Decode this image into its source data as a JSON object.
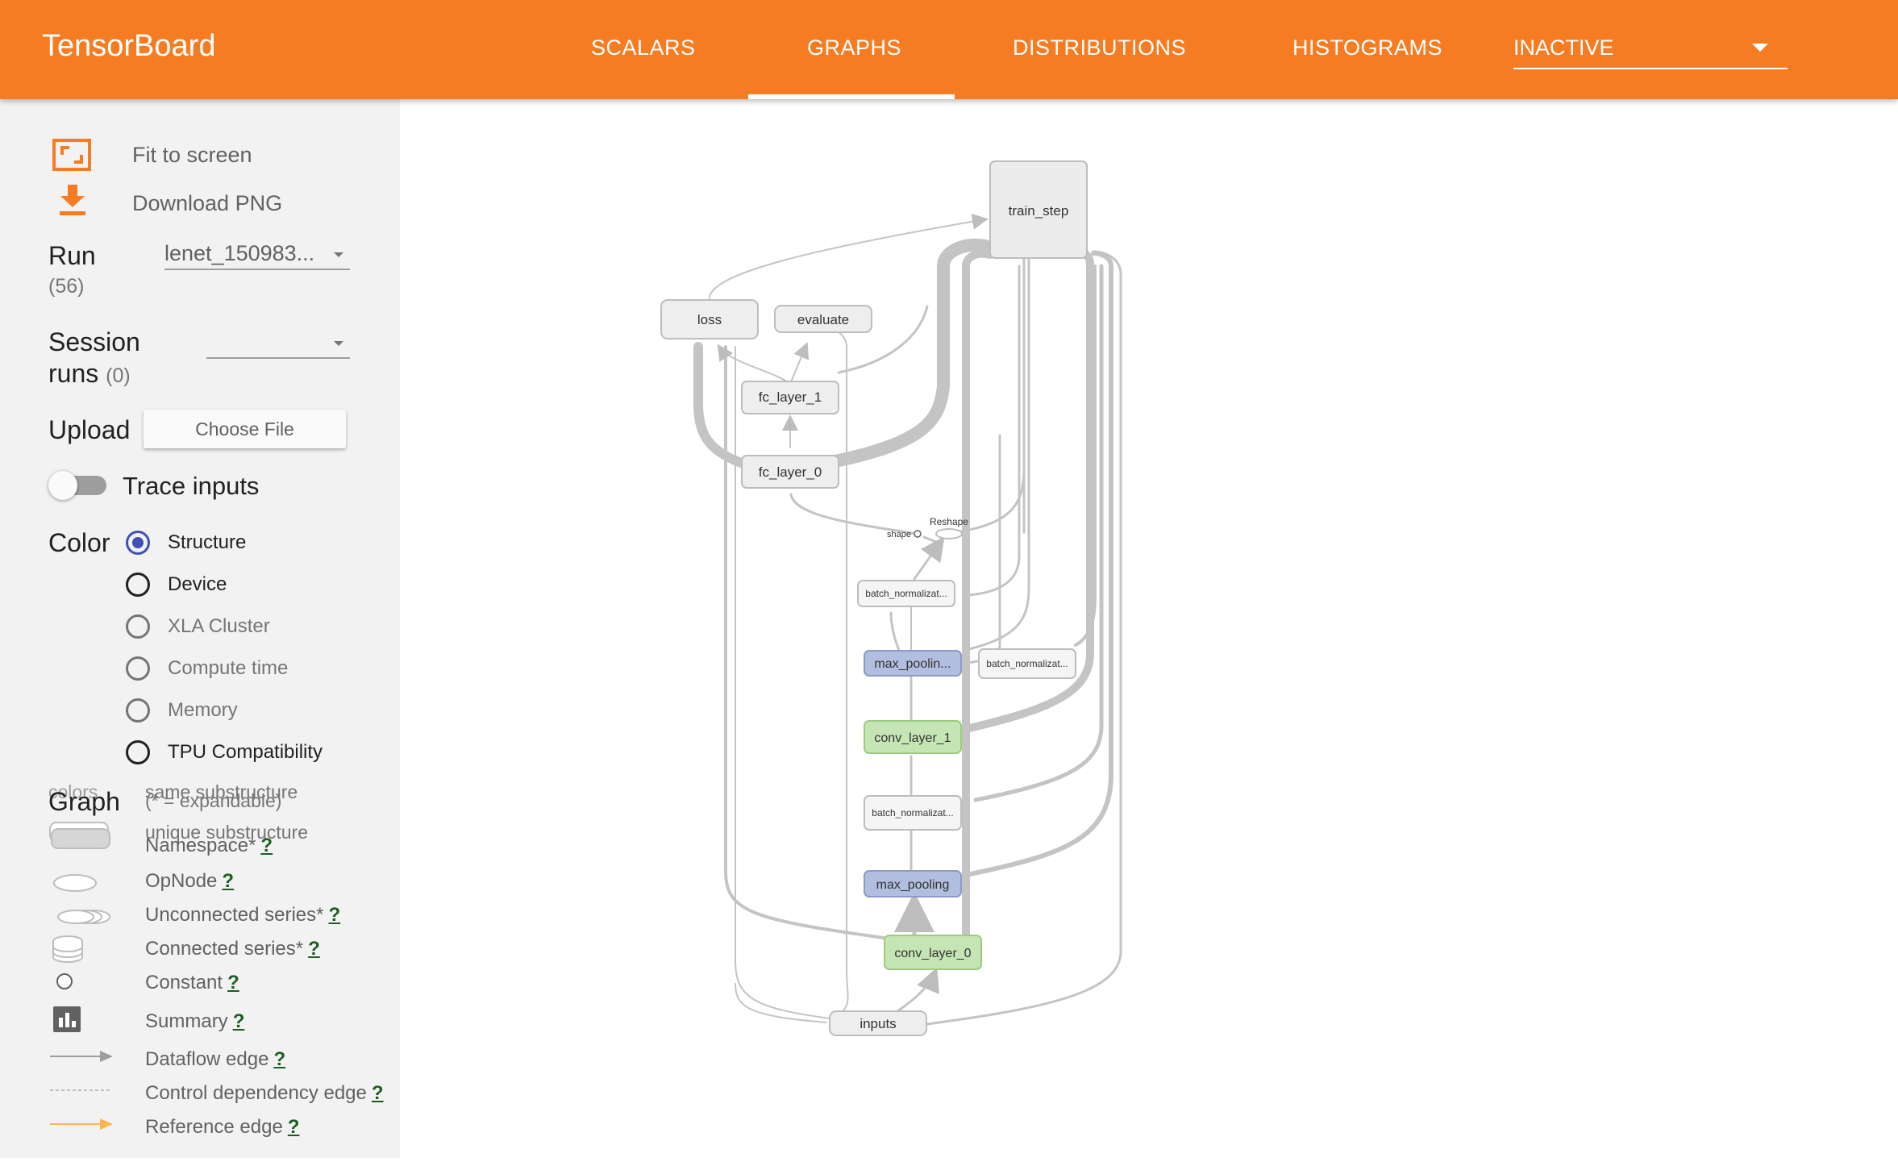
{
  "app_title": "TensorBoard",
  "tabs": [
    {
      "label": "SCALARS"
    },
    {
      "label": "GRAPHS"
    },
    {
      "label": "DISTRIBUTIONS"
    },
    {
      "label": "HISTOGRAMS"
    }
  ],
  "active_tab": "GRAPHS",
  "inactive_dropdown": {
    "value": "INACTIVE"
  },
  "sidebar": {
    "fit_to_screen": "Fit to screen",
    "download_png": "Download PNG",
    "run_label": "Run",
    "run_count": "(56)",
    "run_value": "lenet_150983...",
    "session_label_1": "Session",
    "session_label_2": "runs",
    "session_count": "(0)",
    "session_value": "",
    "upload_label": "Upload",
    "choose_file": "Choose File",
    "trace_inputs": "Trace inputs",
    "trace_inputs_on": false,
    "color_label": "Color",
    "color_options": [
      "Structure",
      "Device",
      "XLA Cluster",
      "Compute time",
      "Memory",
      "TPU Compatibility"
    ],
    "color_selected": "Structure",
    "graph_label": "Graph",
    "colors_label": "colors",
    "expandable_note": "(* = expandable)",
    "same_substructure": "same substructure",
    "unique_substructure": "unique substructure",
    "help_mark": "?",
    "legend": [
      "Namespace*",
      "OpNode",
      "Unconnected series*",
      "Connected series*",
      "Constant",
      "Summary",
      "Dataflow edge",
      "Control dependency edge",
      "Reference edge"
    ]
  },
  "graph": {
    "nodes": {
      "train_step": "train_step",
      "loss": "loss",
      "evaluate": "evaluate",
      "fc_layer_1": "fc_layer_1",
      "fc_layer_0": "fc_layer_0",
      "reshape": "Reshape",
      "shape": "shape",
      "batch_norm_a": "batch_normalizat...",
      "batch_norm_b": "batch_normalizat...",
      "batch_norm_c": "batch_normalizat...",
      "max_pooling_1": "max_poolin...",
      "max_pooling_0": "max_pooling",
      "conv_layer_1": "conv_layer_1",
      "conv_layer_0": "conv_layer_0",
      "inputs": "inputs"
    }
  },
  "colors": {
    "topbar": "#f57c22",
    "accent_blue": "#3f51b5",
    "conv_node": "#c6e5b4",
    "pool_node": "#b2bedf",
    "default_node": "#eeeeee",
    "edge": "#bdbdbd",
    "reference_edge": "#ffb74d"
  },
  "icons": {
    "fit": "fit-to-screen-icon",
    "download": "download-icon",
    "summary": "summary-icon"
  }
}
